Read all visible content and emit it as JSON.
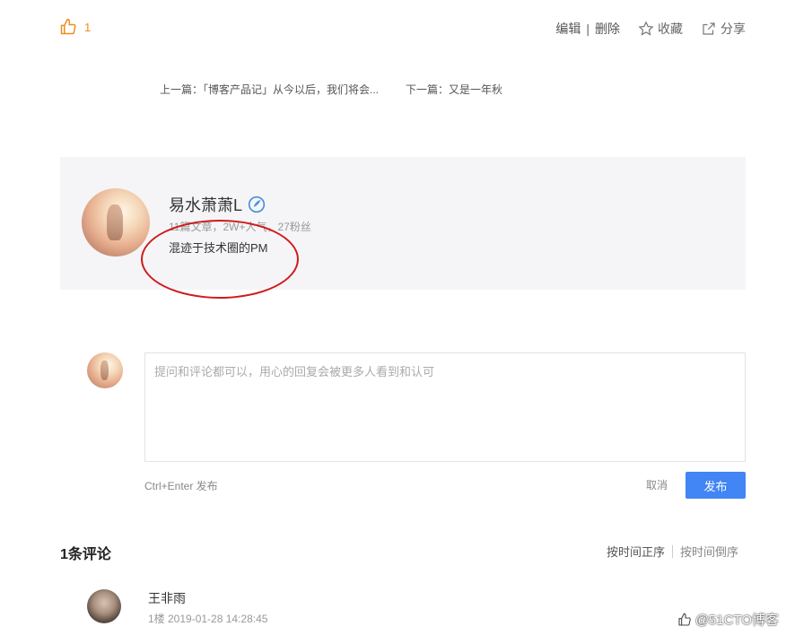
{
  "top": {
    "like_count": "1",
    "edit_label": "编辑",
    "separator": "|",
    "delete_label": "删除",
    "collect_label": "收藏",
    "share_label": "分享"
  },
  "nav": {
    "prev": "上一篇：「博客产品记」从今以后，我们将会...",
    "next": "下一篇：又是一年秋"
  },
  "author": {
    "name": "易水萧萧L",
    "stats": "11篇文章，2W+人气，27粉丝",
    "bio": "混迹于技术圈的PM"
  },
  "comment_form": {
    "placeholder": "提问和评论都可以，用心的回复会被更多人看到和认可",
    "hint": "Ctrl+Enter 发布",
    "cancel_label": "取消",
    "submit_label": "发布"
  },
  "comments": {
    "title": "1条评论",
    "sort_asc": "按时间正序",
    "sort_desc": "按时间倒序",
    "items": [
      {
        "name": "王非雨",
        "meta": "1楼   2019-01-28 14:28:45"
      }
    ]
  },
  "watermark": "@51CTO博客",
  "colors": {
    "accent": "#4285f4",
    "like": "#f08c1a",
    "annotation": "#d01a1a"
  }
}
